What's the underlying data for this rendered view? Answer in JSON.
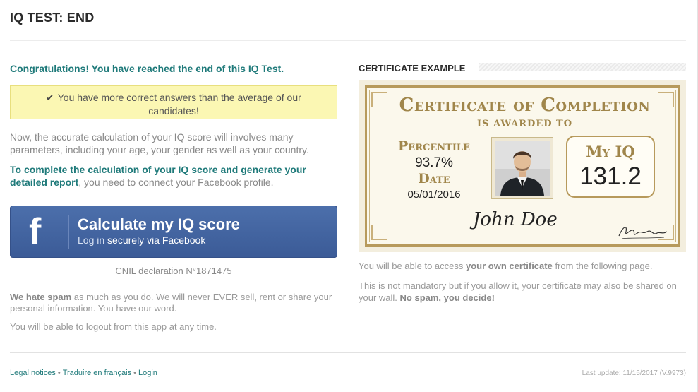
{
  "header": {
    "title": "IQ TEST: END"
  },
  "left": {
    "congrats": "Congratulations! You have reached the end of this IQ Test.",
    "alert_text": "You have more correct answers than the average of our candidates!",
    "para1": "Now, the accurate calculation of your IQ score will involves many parameters, including your age, your gender as well as your country.",
    "para2_strong": "To complete the calculation of your IQ score and generate your detailed report",
    "para2_rest": ", you need to connect your Facebook profile.",
    "fb_button": {
      "title": "Calculate my IQ score",
      "sub_prefix": "Log in",
      "sub_strong": "securely via Facebook"
    },
    "cnil": "CNIL declaration N°1871475",
    "spam_strong": "We hate spam",
    "spam_rest": " as much as you do. We will never EVER sell, rent or share your personal information. You have our word.",
    "logout": "You will be able to logout from this app at any time."
  },
  "right": {
    "heading": "CERTIFICATE EXAMPLE",
    "certificate": {
      "title": "Certificate of Completion",
      "awarded": "IS AWARDED TO",
      "percentile_label": "Percentile",
      "percentile_value": "93.7%",
      "date_label": "Date",
      "date_value": "05/01/2016",
      "iq_label": "My IQ",
      "iq_value": "131.2",
      "name": "John Doe"
    },
    "p1_prefix": "You will be able to access ",
    "p1_strong": "your own certificate",
    "p1_rest": " from the following page.",
    "p2_text": "This is not mandatory but if you allow it, your certificate may also be shared on your wall. ",
    "p2_strong": "No spam, you decide!"
  },
  "footer": {
    "links": [
      "Legal notices",
      "Traduire en français",
      "Login"
    ],
    "separator": "•",
    "last_update": "Last update: 11/15/2017 (V.9973)"
  },
  "colors": {
    "accent": "#1f7a7a",
    "facebook": "#3b5b97",
    "gold": "#a0864b",
    "alert_bg": "#fbf7b3"
  }
}
